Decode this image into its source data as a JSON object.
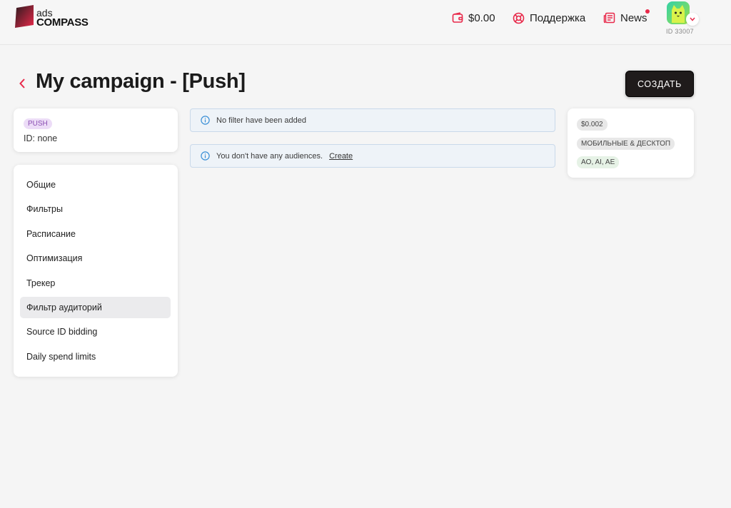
{
  "header": {
    "logo": {
      "line1": "ads",
      "line2": "COMPASS"
    },
    "balance": "$0.00",
    "support": "Поддержка",
    "news": "News",
    "user_id": "ID 33007"
  },
  "page": {
    "title": "My campaign - [Push]",
    "create_button": "СОЗДАТЬ"
  },
  "campaign": {
    "type_badge": "PUSH",
    "id_text": "ID: none"
  },
  "sidebar": {
    "items": [
      {
        "label": "Общие"
      },
      {
        "label": "Фильтры"
      },
      {
        "label": "Расписание"
      },
      {
        "label": "Оптимизация"
      },
      {
        "label": "Трекер"
      },
      {
        "label": "Фильтр аудиторий",
        "active": true
      },
      {
        "label": "Source ID bidding"
      },
      {
        "label": "Daily spend limits"
      }
    ]
  },
  "alerts": {
    "filters": "No filter have been added",
    "audiences": "You don't have any audiences.",
    "audiences_link": "Create"
  },
  "summary": {
    "bid": "$0.002",
    "devices": "МОБИЛЬНЫЕ & ДЕСКТОП",
    "geos": "AO, AI, AE"
  },
  "colors": {
    "accent": "#e8294a",
    "dark_button": "#1f1b1b",
    "alert_bg": "#eef3f8",
    "info_icon": "#3a8fd6"
  }
}
